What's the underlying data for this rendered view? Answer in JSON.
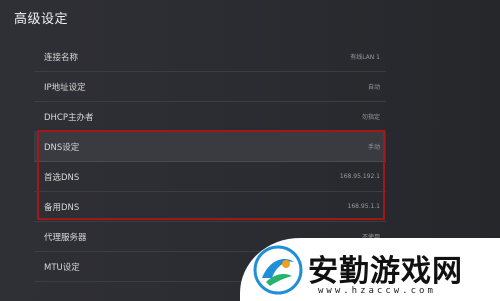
{
  "header": {
    "title": "高级设定"
  },
  "settings": [
    {
      "label": "连接名称",
      "value": "有线LAN 1"
    },
    {
      "label": "IP地址设定",
      "value": "自动"
    },
    {
      "label": "DHCP主办者",
      "value": "勿指定"
    },
    {
      "label": "DNS设定",
      "value": "手动"
    },
    {
      "label": "首选DNS",
      "value": "168.95.192.1"
    },
    {
      "label": "备用DNS",
      "value": "168.95.1.1"
    },
    {
      "label": "代理服务器",
      "value": "不使用"
    },
    {
      "label": "MTU设定",
      "value": ""
    }
  ],
  "watermark": {
    "title": "安勤游戏网",
    "url": "www.hzaccw.com"
  },
  "colors": {
    "highlight": "#a01818",
    "background": "#2b2c31"
  }
}
